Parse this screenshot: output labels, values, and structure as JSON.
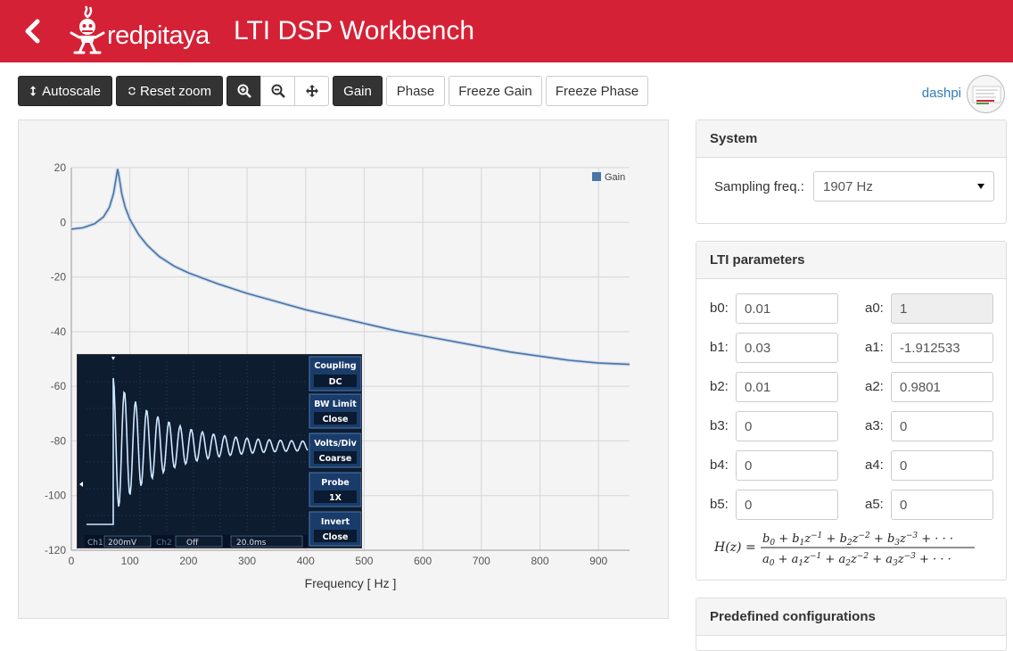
{
  "header": {
    "logo_text": "redpitaya",
    "title": "LTI DSP Workbench"
  },
  "toolbar": {
    "autoscale_label": "Autoscale",
    "reset_zoom_label": "Reset zoom",
    "gain_label": "Gain",
    "phase_label": "Phase",
    "freeze_gain_label": "Freeze Gain",
    "freeze_phase_label": "Freeze Phase"
  },
  "user": {
    "name": "dashpi"
  },
  "chart_data": {
    "type": "line",
    "xlabel": "Frequency [ Hz ]",
    "ylabel": "",
    "xlim": [
      0,
      953
    ],
    "ylim": [
      -120,
      20
    ],
    "xticks": [
      0,
      100,
      200,
      300,
      400,
      500,
      600,
      700,
      800,
      900
    ],
    "yticks": [
      20,
      0,
      -20,
      -40,
      -60,
      -80,
      -100,
      -120
    ],
    "grid": true,
    "legend_position": "top-right",
    "series": [
      {
        "name": "Gain",
        "color": "#4a74a8",
        "x": [
          0,
          20,
          40,
          55,
          65,
          72,
          76,
          79,
          82,
          86,
          92,
          100,
          115,
          130,
          150,
          175,
          200,
          250,
          300,
          350,
          400,
          450,
          500,
          550,
          600,
          650,
          700,
          750,
          800,
          850,
          900,
          953
        ],
        "y": [
          -2.5,
          -2.0,
          -0.5,
          2.0,
          5.5,
          10.5,
          15.5,
          19.5,
          16.0,
          10.5,
          5.5,
          1.0,
          -4.5,
          -8.5,
          -12.5,
          -16.0,
          -18.5,
          -22.5,
          -26.0,
          -29.0,
          -32.0,
          -34.5,
          -37.0,
          -39.5,
          -41.5,
          -43.5,
          -45.5,
          -47.5,
          -49.0,
          -50.5,
          -51.5,
          -52.0
        ]
      }
    ]
  },
  "scope": {
    "coupling_label": "Coupling",
    "coupling_value": "DC",
    "bw_limit_label": "BW Limit",
    "bw_limit_value": "Close",
    "volts_div_label": "Volts/Div",
    "volts_div_value": "Coarse",
    "probe_label": "Probe",
    "probe_value": "1X",
    "invert_label": "Invert",
    "invert_value": "Close",
    "ch1_label": "Ch1",
    "ch1_value": "200mV",
    "ch2_label": "Ch2",
    "ch2_value": "Off",
    "timebase_value": "20.0ms"
  },
  "system": {
    "title": "System",
    "sampling_label": "Sampling freq.:",
    "sampling_value": "1907 Hz"
  },
  "lti": {
    "title": "LTI parameters",
    "b_labels": [
      "b0:",
      "b1:",
      "b2:",
      "b3:",
      "b4:",
      "b5:"
    ],
    "b_values": [
      "0.01",
      "0.03",
      "0.01",
      "0",
      "0",
      "0"
    ],
    "a_labels": [
      "a0:",
      "a1:",
      "a2:",
      "a3:",
      "a4:",
      "a5:"
    ],
    "a_values": [
      "1",
      "-1.912533",
      "0.9801",
      "0",
      "0",
      "0"
    ]
  },
  "predefined": {
    "title": "Predefined configurations"
  },
  "colors": {
    "brand": "#d52136",
    "dark_button": "#333333",
    "link": "#2e7bbf"
  }
}
